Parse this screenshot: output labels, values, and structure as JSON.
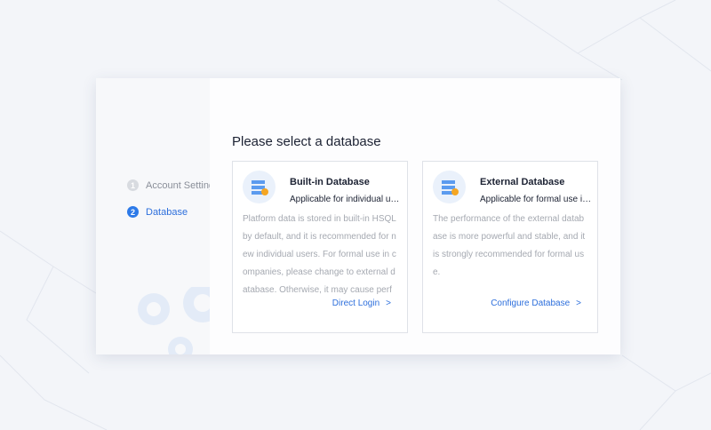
{
  "steps": [
    {
      "num": "1",
      "label": "Account Settings"
    },
    {
      "num": "2",
      "label": "Database"
    }
  ],
  "title": "Please select a database",
  "cards": [
    {
      "title": "Built-in Database",
      "subtitle": "Applicable for individual users",
      "desc": "Platform data is stored in built-in HSQL by default, and it is recommended for new individual users. For formal use in companies, please change to external database. Otherwise, it may cause performance problems.",
      "link": "Direct Login"
    },
    {
      "title": "External Database",
      "subtitle": "Applicable for formal use in companies",
      "desc": "The performance of the external database is more powerful and stable, and it is strongly recommended for formal use.",
      "link": "Configure Database"
    }
  ],
  "colors": {
    "accent": "#2d6fdc"
  }
}
